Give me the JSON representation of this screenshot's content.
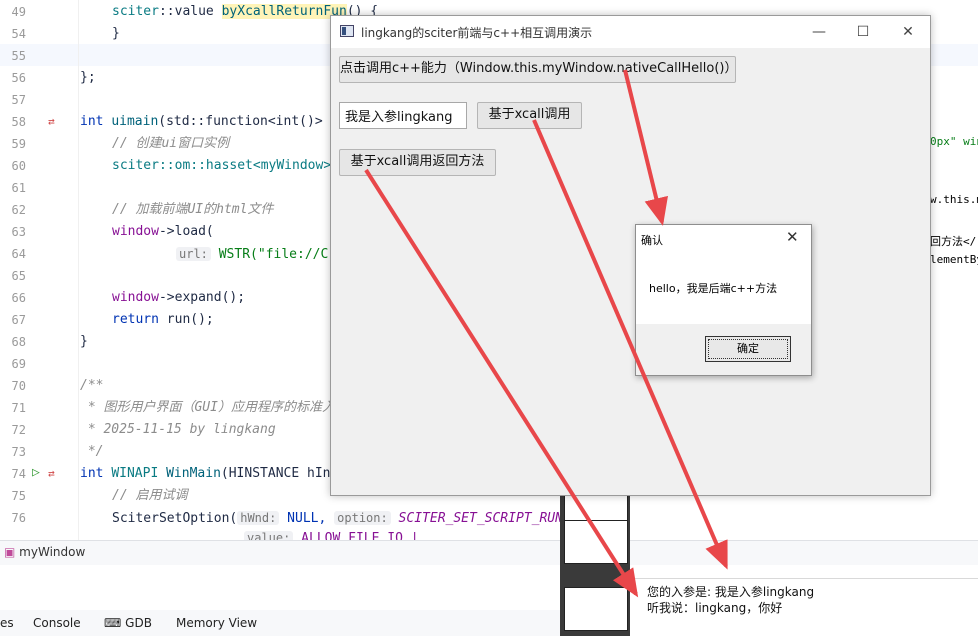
{
  "editor": {
    "line_numbers": [
      "49",
      "54",
      "55",
      "56",
      "57",
      "58",
      "59",
      "60",
      "61",
      "62",
      "63",
      "64",
      "65",
      "66",
      "67",
      "68",
      "69",
      "70",
      "71",
      "72",
      "73",
      "74",
      "75",
      "76"
    ],
    "lines": {
      "l49_a": "sciter",
      "l49_b": "::value ",
      "l49_c": "byXcallReturnFun",
      "l49_d": "() {",
      "l54": "}",
      "l56": "};",
      "l58_a": "int ",
      "l58_b": "uimain",
      "l58_c": "(std::function<int()> ",
      "l59": "// 创建ui窗口实例",
      "l60_a": "sciter::om::hasset<myWindow",
      "l60_b": ">",
      "l62": "// 加载前端UI的html文件",
      "l63_a": "window",
      "l63_b": "->load(",
      "l64_hint": "url:",
      "l64_str": "WSTR(\"file://C:\\",
      "l66_a": "window",
      "l66_b": "->expand();",
      "l67_a": "return ",
      "l67_b": "run();",
      "l68": "}",
      "l70": "/**",
      "l71": " * 图形用户界面（GUI）应用程序的标准入",
      "l72": " * 2025-11-15 by lingkang",
      "l73": " */",
      "l74_a": "int ",
      "l74_b": "WINAPI ",
      "l74_c": "WinMain",
      "l74_d": "(HINSTANCE hIn",
      "l75": "// 启用试调",
      "l76_a": "SciterSetOption(",
      "l76_hint1": "hWnd:",
      "l76_b": " NULL, ",
      "l76_hint2": "option:",
      "l76_c": " SCITER_SET_SCRIPT_RUN",
      "l77_hint": "value:",
      "l77_c": " ALLOW_FILE_IO |"
    },
    "right_strip": [
      "0px\" win",
      "w.this.m",
      "回方法</",
      "lementBy"
    ]
  },
  "run_panel": {
    "run_tab_label": "myWindow",
    "bottom_tabs": [
      "es",
      "Console",
      "GDB",
      "Memory View"
    ],
    "output_lines": [
      "您的入参是: 我是入参lingkang",
      "听我说：lingkang，你好"
    ]
  },
  "app_window": {
    "title": "lingkang的sciter前端与c++相互调用演示",
    "controls": {
      "minimize": "—",
      "maximize": "☐",
      "close": "✕"
    },
    "native_call_button": "点击调用c++能力（Window.this.myWindow.nativeCallHello()）",
    "input_value": "我是入参lingkang",
    "xcall_button": "基于xcall调用",
    "xcall_return_button": "基于xcall调用返回方法"
  },
  "dialog": {
    "title": "确认",
    "close": "✕",
    "message": "hello，我是后端c++方法",
    "ok_button": "确定"
  },
  "colors": {
    "arrow": "#e8474a",
    "accent": "#0033b3"
  }
}
